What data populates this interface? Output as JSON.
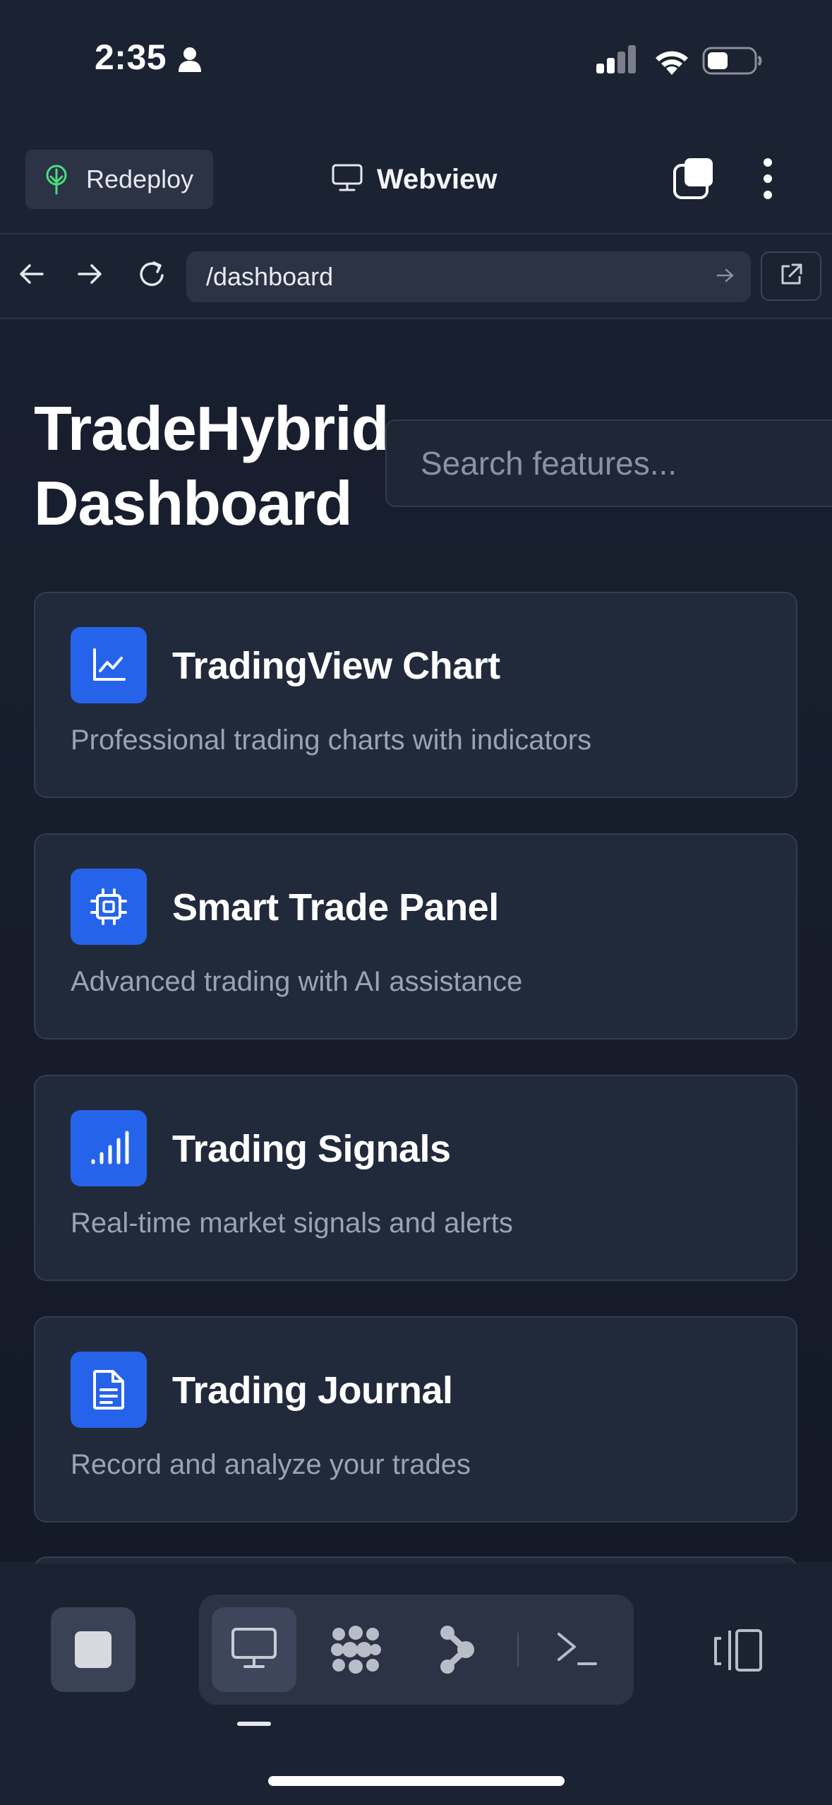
{
  "status_bar": {
    "time": "2:35"
  },
  "toolbar": {
    "redeploy_label": "Redeploy",
    "webview_label": "Webview"
  },
  "url_bar": {
    "path": "/dashboard"
  },
  "page": {
    "title_line1": "TradeHybrid",
    "title_line2": "Dashboard",
    "search_placeholder": "Search features...",
    "cards": [
      {
        "icon": "chart-line-icon",
        "title": "TradingView Chart",
        "description": "Professional trading charts with indicators"
      },
      {
        "icon": "cpu-chip-icon",
        "title": "Smart Trade Panel",
        "description": "Advanced trading with AI assistance"
      },
      {
        "icon": "signal-bars-icon",
        "title": "Trading Signals",
        "description": "Real-time market signals and alerts"
      },
      {
        "icon": "document-icon",
        "title": "Trading Journal",
        "description": "Record and analyze your trades"
      }
    ]
  },
  "colors": {
    "accent": "#2563eb",
    "background": "#1b2232",
    "card": "#212a3b",
    "muted_text": "#9aa3b4"
  }
}
